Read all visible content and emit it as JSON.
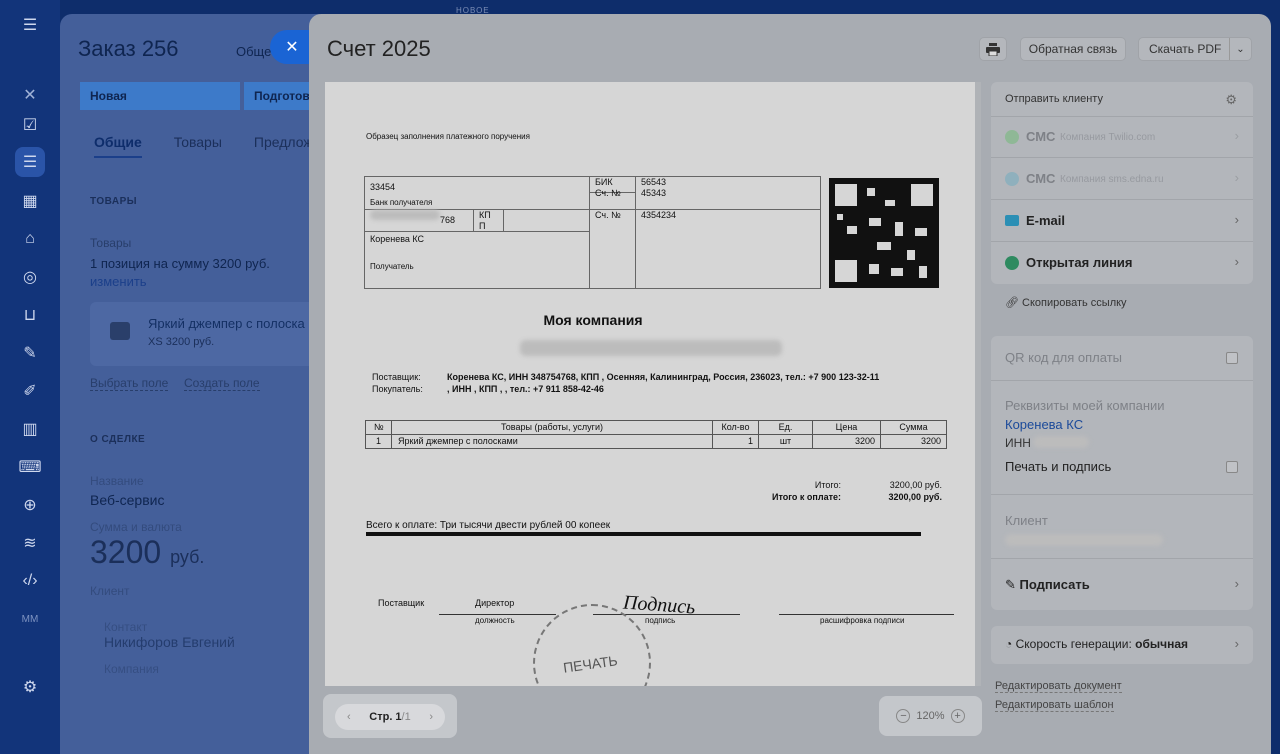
{
  "order": {
    "title": "Заказ 256",
    "general_tab": "Общее",
    "stages": [
      "Новая",
      "Подготовк"
    ],
    "tabs": [
      "Общие",
      "Товары",
      "Предлож"
    ],
    "section_goods": "ТОВАРЫ",
    "goods_label": "Товары",
    "goods_summary": "1 позиция на сумму 3200 руб.",
    "change_link": "изменить",
    "product_name": "Яркий джемпер с полоска",
    "product_sub": "XS  3200 руб.",
    "choose_field": "Выбрать поле",
    "create_field": "Создать поле",
    "section_deal": "О СДЕЛКЕ",
    "name_label": "Название",
    "name_value": "Веб-сервис",
    "sum_label": "Сумма и валюта",
    "sum_value": "3200",
    "sum_currency": "руб.",
    "client_label": "Клиент",
    "contact_label": "Контакт",
    "contact_value": "Никифоров Евгений",
    "company_label": "Компания"
  },
  "rail_new_badge": "НОВОЕ",
  "rail_mm": "MM",
  "invoice": {
    "title": "Счет 2025",
    "print_icon": "printer-icon",
    "feedback": "Обратная связь",
    "download": "Скачать PDF"
  },
  "document": {
    "sample_title": "Образец заполнения платежного поручения",
    "inn_prefix": "33454",
    "bank_label": "Банк получателя",
    "num_768": "768",
    "kpp": "КП П",
    "recipient_name": "Коренева КС",
    "recipient_label": "Получатель",
    "bik_label": "БИК",
    "bik_value": "56543",
    "acc_label": "Сч. №",
    "acc_value": "45343",
    "acc2_label": "Сч. №",
    "acc2_value": "4354234",
    "company": "Моя компания",
    "supplier_label": "Поставщик:",
    "supplier_value": "Коренева КС, ИНН 348754768, КПП , Осенняя, Калининград, Россия, 236023, тел.: +7 900 123-32-11",
    "buyer_label": "Покупатель:",
    "buyer_value": ", ИНН , КПП , , тел.: +7 911 858-42-46",
    "table_headers": [
      "№",
      "Товары (работы, услуги)",
      "Кол-во",
      "Ед.",
      "Цена",
      "Сумма"
    ],
    "table_row": [
      "1",
      "Яркий джемпер с полосками",
      "1",
      "шт",
      "3200",
      "3200"
    ],
    "total_label": "Итого:",
    "total_value": "3200,00 руб.",
    "topay_label": "Итого к оплате:",
    "topay_value": "3200,00 руб.",
    "sum_words": "Всего к оплате: Три тысячи двести рублей 00 копеек",
    "sign_supplier": "Поставщик",
    "sign_director": "Директор",
    "sign_position": "должность",
    "sign_signature": "подпись",
    "sign_decode": "расшифровка подписи",
    "signature_script": "Подпись",
    "stamp": "ПЕЧАТЬ"
  },
  "pager": {
    "page_label": "Стр. 1",
    "page_total": "/1"
  },
  "zoom": {
    "value": "120%"
  },
  "send": {
    "title": "Отправить клиенту",
    "items": [
      {
        "label": "СМС",
        "sub": "Компания Twilio.com",
        "icon": "whatsapp-icon"
      },
      {
        "label": "СМС",
        "sub": "Компания sms.edna.ru",
        "icon": "chat-icon"
      },
      {
        "label": "E-mail",
        "sub": "",
        "icon": "mail-icon"
      },
      {
        "label": "Открытая линия",
        "sub": "",
        "icon": "openline-icon"
      }
    ],
    "copy_link": "Скопировать ссылку"
  },
  "settings": {
    "qr_label": "QR код для оплаты",
    "requisites_label": "Реквизиты моей компании",
    "requisites_value": "Коренева КС",
    "inn_label": "ИНН",
    "print_sign": "Печать и подпись",
    "client_label": "Клиент",
    "sign_label": "Подписать"
  },
  "speed": {
    "label": "Скорость генерации:",
    "value": "обычная"
  },
  "links": {
    "edit_doc": "Редактировать документ",
    "edit_template": "Редактировать шаблон"
  },
  "colors": {
    "accent": "#1a64d4",
    "rail": "#12347a",
    "panel": "#a8acb2"
  }
}
